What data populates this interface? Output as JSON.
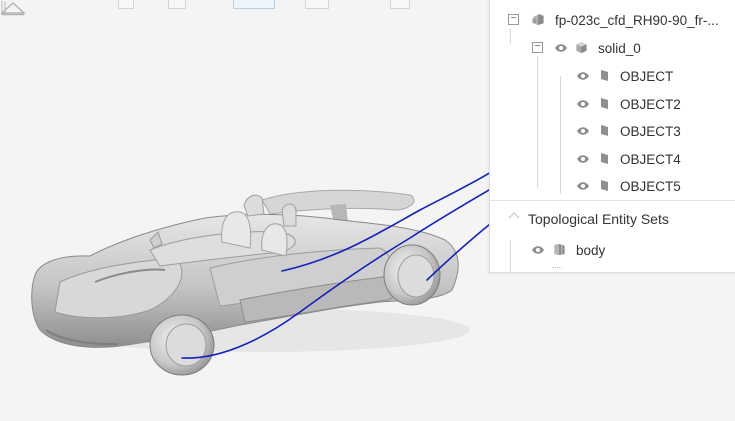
{
  "tree": {
    "file_node": {
      "label": "fp-023c_cfd_RH90-90_fr-...",
      "icon": "assembly-icon"
    },
    "solid_node": {
      "label": "solid_0",
      "icon": "solid-cube-icon"
    },
    "objects": [
      {
        "label": "OBJECT",
        "icon": "face-icon"
      },
      {
        "label": "OBJECT2",
        "icon": "face-icon"
      },
      {
        "label": "OBJECT3",
        "icon": "face-icon"
      },
      {
        "label": "OBJECT4",
        "icon": "face-icon"
      },
      {
        "label": "OBJECT5",
        "icon": "face-icon"
      }
    ]
  },
  "topological_section": {
    "title": "Topological Entity Sets",
    "items": [
      {
        "label": "body",
        "icon": "entity-set-icon"
      }
    ]
  },
  "colors": {
    "annotation_stroke": "#1520b8",
    "panel_background": "#ffffff",
    "viewport_background": "#f4f4f4",
    "car_body": "#c9c9c9"
  }
}
